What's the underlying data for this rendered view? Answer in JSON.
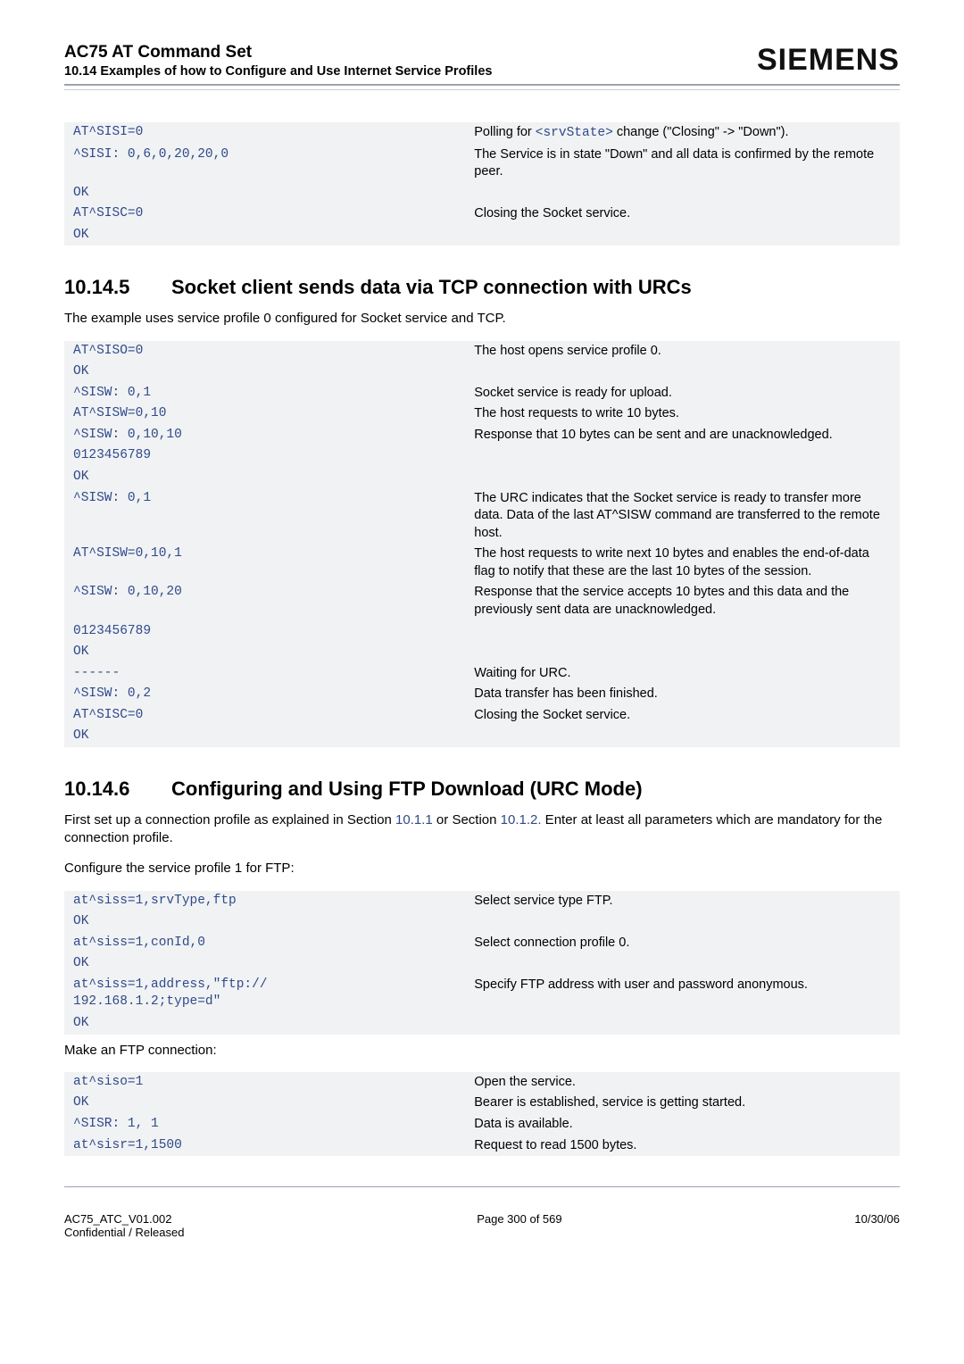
{
  "header": {
    "title": "AC75 AT Command Set",
    "subtitle": "10.14 Examples of how to Configure and Use Internet Service Profiles",
    "brand": "SIEMENS"
  },
  "intro_block": [
    {
      "code": "AT^SISI=0",
      "desc_pre": "Polling for ",
      "link": "<srvState>",
      "desc_post": " change (\"Closing\" -> \"Down\")."
    },
    {
      "code": "^SISI: 0,6,0,20,20,0",
      "desc": "The Service is in state \"Down\" and all data is confirmed by the remote peer."
    },
    {
      "code": "OK",
      "desc": ""
    },
    {
      "code": "AT^SISC=0",
      "desc": "Closing the Socket service."
    },
    {
      "code": "OK",
      "desc": ""
    }
  ],
  "sec1": {
    "num": "10.14.5",
    "title": "Socket client sends data via TCP connection with URCs",
    "intro": "The example uses service profile 0 configured for Socket service and TCP.",
    "rows": [
      {
        "code": "AT^SISO=0",
        "desc": "The host opens service profile 0."
      },
      {
        "code": "OK",
        "desc": ""
      },
      {
        "code": "^SISW: 0,1",
        "desc": "Socket service is ready for upload."
      },
      {
        "code": "AT^SISW=0,10",
        "desc": "The host requests to write 10 bytes."
      },
      {
        "code": "^SISW: 0,10,10",
        "desc": "Response that 10 bytes can be sent and are unacknowledged."
      },
      {
        "code": "0123456789",
        "desc": ""
      },
      {
        "code": "OK",
        "desc": ""
      },
      {
        "code": "^SISW: 0,1",
        "desc": "The URC indicates that the Socket service is ready to transfer more data. Data of the last AT^SISW command are transferred to the remote host."
      },
      {
        "code": "AT^SISW=0,10,1",
        "desc": "The host requests to write next 10 bytes and enables the end-of-data flag to notify that these are the last 10 bytes of the session."
      },
      {
        "code": "^SISW: 0,10,20",
        "desc": "Response that the service accepts 10 bytes and this data and the previously sent data are unacknowledged."
      },
      {
        "code": "0123456789",
        "desc": ""
      },
      {
        "code": "OK",
        "desc": ""
      },
      {
        "code": "------",
        "desc": "Waiting for URC."
      },
      {
        "code": "^SISW: 0,2",
        "desc": "Data transfer has been finished."
      },
      {
        "code": "AT^SISC=0",
        "desc": "Closing the Socket service."
      },
      {
        "code": "OK",
        "desc": ""
      }
    ]
  },
  "sec2": {
    "num": "10.14.6",
    "title": "Configuring and Using FTP Download (URC Mode)",
    "intro_pre": "First set up a connection profile as explained in Section ",
    "link1": "10.1.1",
    "intro_mid": " or Section ",
    "link2": "10.1.2.",
    "intro_post": " Enter at least all parameters which are mandatory for the connection profile.",
    "sub1": "Configure the service profile 1 for FTP:",
    "rows1": [
      {
        "code": "at^siss=1,srvType,ftp",
        "desc": "Select service type FTP."
      },
      {
        "code": "OK",
        "desc": ""
      },
      {
        "code": "at^siss=1,conId,0",
        "desc": "Select connection profile 0."
      },
      {
        "code": "OK",
        "desc": ""
      },
      {
        "code": "at^siss=1,address,\"ftp://\n192.168.1.2;type=d\"",
        "desc": "Specify FTP address with user and password anonymous."
      },
      {
        "code": "OK",
        "desc": ""
      }
    ],
    "sub2": "Make an FTP connection:",
    "rows2": [
      {
        "code": "at^siso=1",
        "desc": "Open the service."
      },
      {
        "code": "OK",
        "desc": "Bearer is established, service is getting started."
      },
      {
        "code": "^SISR: 1, 1",
        "desc": "Data is available."
      },
      {
        "code": "at^sisr=1,1500",
        "desc": "Request to read 1500 bytes."
      }
    ]
  },
  "footer": {
    "left1": "AC75_ATC_V01.002",
    "left2": "Confidential / Released",
    "center": "Page 300 of 569",
    "right": "10/30/06"
  }
}
